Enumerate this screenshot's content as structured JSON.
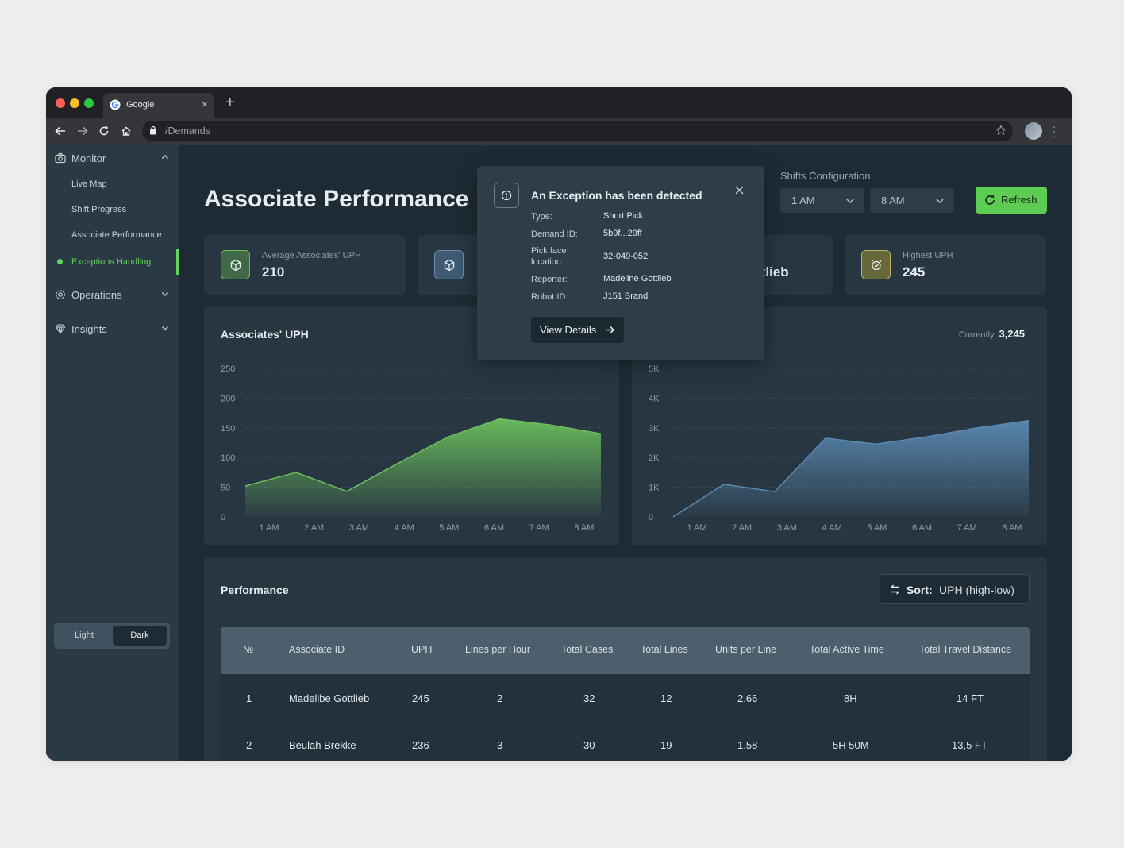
{
  "browser": {
    "tab_title": "Google",
    "url": "/Demands"
  },
  "sidebar": {
    "groups": [
      {
        "label": "Monitor",
        "icon": "camera-icon",
        "expanded": true
      },
      {
        "label": "Operations",
        "icon": "gear-icon",
        "expanded": false
      },
      {
        "label": "Insights",
        "icon": "gem-icon",
        "expanded": false
      }
    ],
    "items": [
      {
        "label": "Live Map",
        "active": false
      },
      {
        "label": "Shift Progress",
        "active": false
      },
      {
        "label": "Associate Performance",
        "active": false
      },
      {
        "label": "Exceptions Handling",
        "active": true
      }
    ],
    "theme": {
      "light": "Light",
      "dark": "Dark",
      "selected": "Dark"
    }
  },
  "header": {
    "title": "Associate Performance",
    "shifts_label": "Shifts Configuration",
    "shift_start": "1 AM",
    "shift_end": "8 AM",
    "refresh_label": "Refresh"
  },
  "stats": [
    {
      "label": "Average Associates' UPH",
      "value": "210",
      "icon": "cube-icon"
    },
    {
      "label": "",
      "value": "",
      "icon": "cube-icon"
    },
    {
      "label": "",
      "value": "ttlieb",
      "icon": ""
    },
    {
      "label": "Highest UPH",
      "value": "245",
      "icon": "alarm-icon"
    }
  ],
  "charts": {
    "left": {
      "title": "Associates' UPH"
    },
    "right": {
      "currently_label": "Currently",
      "currently_value": "3,245"
    }
  },
  "chart_data": [
    {
      "type": "area",
      "title": "Associates' UPH",
      "x": [
        "1 AM",
        "2 AM",
        "3 AM",
        "4 AM",
        "5 AM",
        "6 AM",
        "7 AM",
        "8 AM"
      ],
      "y_ticks": [
        "0",
        "50",
        "100",
        "150",
        "200",
        "250"
      ],
      "ylim": [
        0,
        250
      ],
      "series": [
        {
          "values": [
            52,
            75,
            43,
            90,
            135,
            165,
            155,
            140
          ]
        }
      ],
      "color": "#6cbf5d",
      "grid": true
    },
    {
      "type": "area",
      "x": [
        "1 AM",
        "2 AM",
        "3 AM",
        "4 AM",
        "5 AM",
        "6 AM",
        "7 AM",
        "8 AM"
      ],
      "y_ticks": [
        "0",
        "1K",
        "2K",
        "3K",
        "4K",
        "5K"
      ],
      "ylim": [
        0,
        5000
      ],
      "series": [
        {
          "values": [
            0,
            1100,
            850,
            2650,
            2450,
            2700,
            3000,
            3245
          ]
        }
      ],
      "color": "#5b8ab4",
      "grid": true
    }
  ],
  "performance": {
    "title": "Performance",
    "sort_key": "Sort:",
    "sort_value": "UPH (high-low)",
    "columns": [
      "№",
      "Associate ID",
      "UPH",
      "Lines per Hour",
      "Total Cases",
      "Total Lines",
      "Units per Line",
      "Total Active Time",
      "Total Travel Distance"
    ],
    "rows": [
      [
        "1",
        "Madelibe Gottlieb",
        "245",
        "2",
        "32",
        "12",
        "2.66",
        "8H",
        "14 FT"
      ],
      [
        "2",
        "Beulah Brekke",
        "236",
        "3",
        "30",
        "19",
        "1.58",
        "5H 50M",
        "13,5 FT"
      ]
    ]
  },
  "popup": {
    "title": "An Exception has been detected",
    "fields": [
      {
        "key": "Type:",
        "value": "Short Pick"
      },
      {
        "key": "Demand ID:",
        "value": "5b9f...29ff"
      },
      {
        "key": "Pick face location:",
        "value": "32-049-052"
      },
      {
        "key": "Reporter:",
        "value": "Madeline Gottlieb"
      },
      {
        "key": "Robot ID:",
        "value": "J151 Brandi"
      }
    ],
    "button_label": "View Details"
  },
  "colors": {
    "accent": "#5dcc52",
    "sidebar_bg": "#2a3a44",
    "card_bg": "#273641",
    "page_bg": "#1f2b34"
  }
}
